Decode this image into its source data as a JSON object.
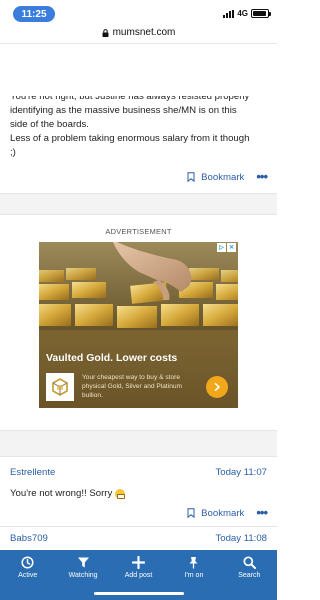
{
  "status_bar": {
    "time": "11:25",
    "network": "4G",
    "battery_level": 0.9
  },
  "browser": {
    "url": "mumsnet.com"
  },
  "post": {
    "partial_line": "You're not right, but Justine has always resisted properly",
    "lines": [
      "identifying as the massive business she/MN is on this",
      "side of the boards.",
      "Less of a problem taking enormous salary from it though",
      ";)"
    ],
    "bookmark_label": "Bookmark",
    "more_label": "•••"
  },
  "ad": {
    "label": "ADVERTISEMENT",
    "title": "Vaulted Gold. Lower costs",
    "description": "Your cheapest way to buy & store physical Gold, Silver and Platinum bullion.",
    "choices_icon": "ad-choices-icon",
    "colors": {
      "accent": "#f0a81a",
      "background": "#6b5a36"
    }
  },
  "reply": {
    "author": "Estrellente",
    "time": "Today 11:07",
    "text": "You're not wrong!! Sorry",
    "bookmark_label": "Bookmark",
    "more_label": "•••"
  },
  "next_post": {
    "author": "Babs709",
    "time": "Today 11:08"
  },
  "bottom_nav": {
    "items": [
      {
        "label": "Active",
        "icon": "clock-icon"
      },
      {
        "label": "Watching",
        "icon": "filter-icon"
      },
      {
        "label": "Add post",
        "icon": "plus-icon"
      },
      {
        "label": "I'm on",
        "icon": "pin-icon"
      },
      {
        "label": "Search",
        "icon": "search-icon"
      }
    ],
    "color": "#2a6db3"
  },
  "colors": {
    "link": "#2a5fa8",
    "time_pill": "#3a7ddc"
  }
}
